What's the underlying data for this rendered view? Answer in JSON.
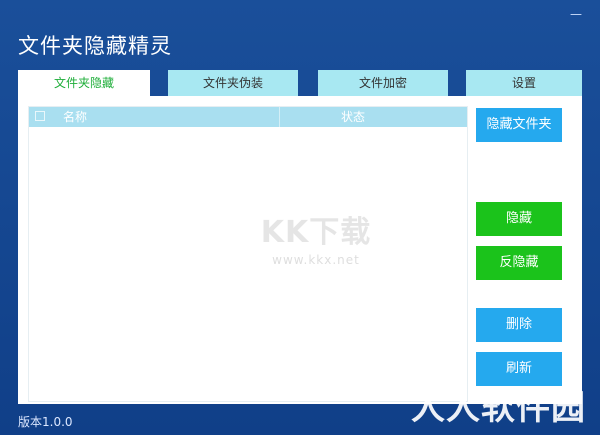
{
  "window": {
    "title": "文件夹隐藏精灵",
    "minimize_glyph": "—"
  },
  "tabs": [
    {
      "label": "文件夹隐藏",
      "active": true
    },
    {
      "label": "文件夹伪装",
      "active": false
    },
    {
      "label": "文件加密",
      "active": false
    },
    {
      "label": "设置",
      "active": false
    }
  ],
  "list": {
    "columns": [
      "名称",
      "状态"
    ],
    "rows": []
  },
  "buttons": {
    "hide_folder": "隐藏文件夹",
    "hide": "隐藏",
    "unhide": "反隐藏",
    "delete": "删除",
    "refresh": "刷新"
  },
  "footer": {
    "version": "版本1.0.0"
  },
  "watermarks": {
    "center_logo": "KK下载",
    "center_url": "www.kkx.net",
    "corner": "人人软件园"
  },
  "colors": {
    "window_bg": "#0f3f8c",
    "tab_inactive": "#a8e8f2",
    "tab_active_text": "#1fae3a",
    "button_blue": "#25a9ee",
    "button_green": "#1bc31b",
    "list_header": "#a9dff0"
  },
  "icons": [
    "minimize-icon",
    "checkbox-icon"
  ]
}
